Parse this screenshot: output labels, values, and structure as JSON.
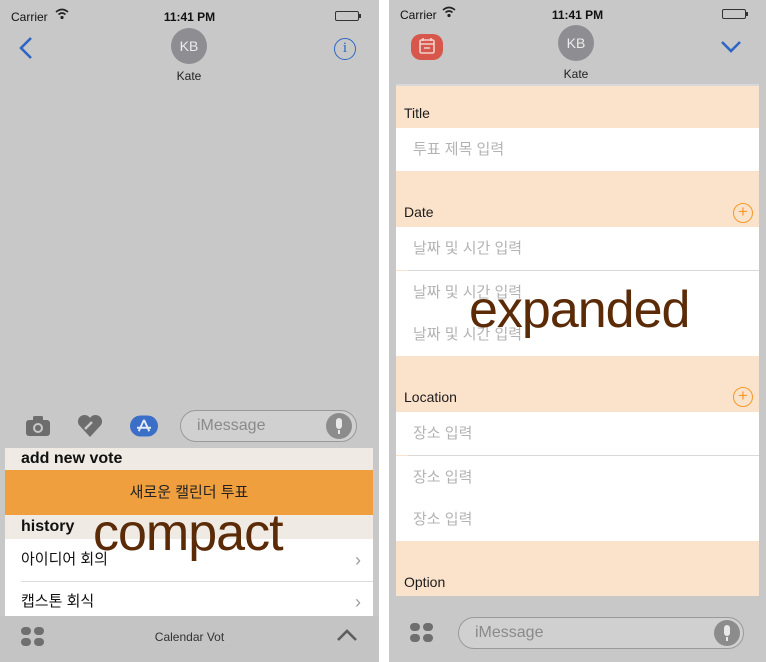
{
  "status_bar": {
    "carrier": "Carrier",
    "time": "11:41 PM"
  },
  "contact": {
    "initials": "KB",
    "name": "Kate"
  },
  "compact": {
    "message_placeholder": "iMessage",
    "add_new_vote_header": "add new vote",
    "new_vote_button": "새로운 캘린더 투표",
    "history_header": "history",
    "history_items": [
      "아이디어 회의",
      "캡스톤 회식"
    ],
    "drawer_title": "Calendar Vot",
    "overlay_label": "compact"
  },
  "expanded": {
    "title_label": "Title",
    "title_placeholder": "투표 제목 입력",
    "date_label": "Date",
    "date_placeholders": [
      "날짜 및 시간 입력",
      "날짜 및 시간 입력",
      "날짜 및 시간 입력"
    ],
    "location_label": "Location",
    "location_placeholders": [
      "장소 입력",
      "장소 입력",
      "장소 입력"
    ],
    "option_label": "Option",
    "message_placeholder": "iMessage",
    "overlay_label": "expanded"
  },
  "icons": {
    "back": "back-chevron-icon",
    "info": "info-icon",
    "collapse": "chevron-down-icon",
    "expand": "chevron-up-icon"
  },
  "colors": {
    "accent_orange": "#ef9f3e",
    "form_background": "#fbe2cb",
    "ios_blue": "#2e66c4",
    "overlay_text": "#5b2a07"
  }
}
